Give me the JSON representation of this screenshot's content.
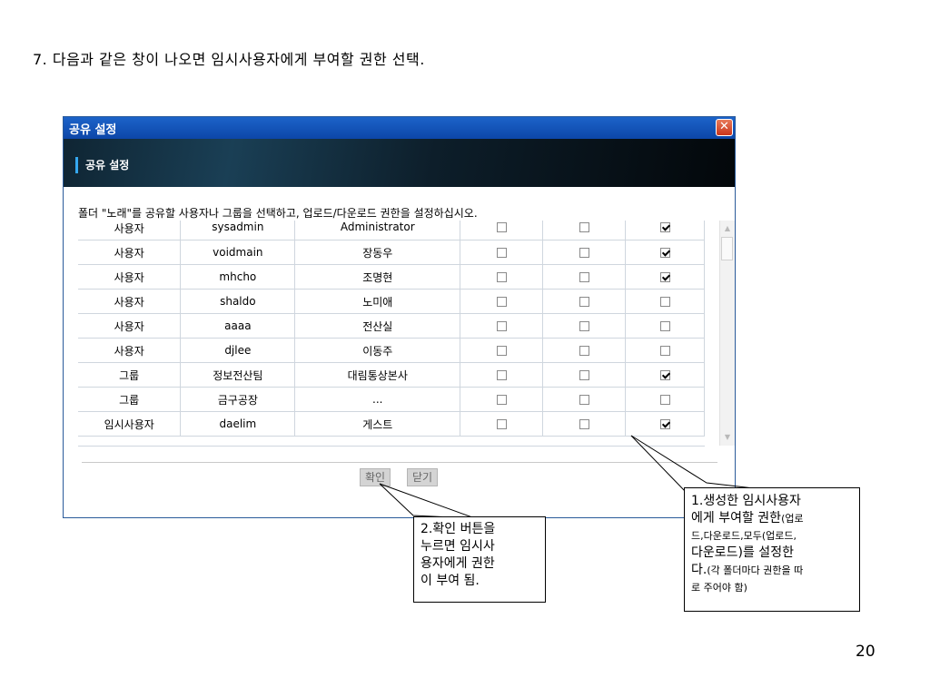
{
  "slide": {
    "step_text": "7. 다음과 같은 창이 나오면 임시사용자에게 부여할 권한 선택.",
    "page_number": "20"
  },
  "dialog": {
    "title": "공유 설정",
    "close_glyph": "✕",
    "banner_title": "공유 설정",
    "instruction": "폴더 \"노래\"를 공유할 사용자나 그룹을 선택하고, 업로드/다운로드 권한을 설정하십시오.",
    "rows": [
      {
        "type": "사용자",
        "id": "sysadmin",
        "name": "Administrator",
        "upload": false,
        "download": false,
        "all": true
      },
      {
        "type": "사용자",
        "id": "voidmain",
        "name": "장동우",
        "upload": false,
        "download": false,
        "all": true
      },
      {
        "type": "사용자",
        "id": "mhcho",
        "name": "조명현",
        "upload": false,
        "download": false,
        "all": true
      },
      {
        "type": "사용자",
        "id": "shaldo",
        "name": "노미애",
        "upload": false,
        "download": false,
        "all": false
      },
      {
        "type": "사용자",
        "id": "aaaa",
        "name": "전산실",
        "upload": false,
        "download": false,
        "all": false
      },
      {
        "type": "사용자",
        "id": "djlee",
        "name": "이동주",
        "upload": false,
        "download": false,
        "all": false
      },
      {
        "type": "그룹",
        "id": "정보전산팀",
        "name": "대림통상본사",
        "upload": false,
        "download": false,
        "all": true
      },
      {
        "type": "그룹",
        "id": "금구공장",
        "name": "...",
        "upload": false,
        "download": false,
        "all": false
      },
      {
        "type": "임시사용자",
        "id": "daelim",
        "name": "게스트",
        "upload": false,
        "download": false,
        "all": true
      }
    ],
    "buttons": {
      "ok": "확인",
      "close": "닫기"
    }
  },
  "callouts": {
    "c1_line1": "1.생성한 임시사용자",
    "c1_line2a": "에게 부여할 권한",
    "c1_line2b": "(업로",
    "c1_line3": "드,다운로드,모두(업로드,",
    "c1_line4": "다운로드)를 설정한",
    "c1_line5a": "다.",
    "c1_line5b": "(각 폴더마다 권한을 따",
    "c1_line6": "로 주어야 함)",
    "c2_line1": "2.확인 버튼을",
    "c2_line2": "누르면 임시사",
    "c2_line3": "용자에게 권한",
    "c2_line4": "이 부여 됨."
  }
}
